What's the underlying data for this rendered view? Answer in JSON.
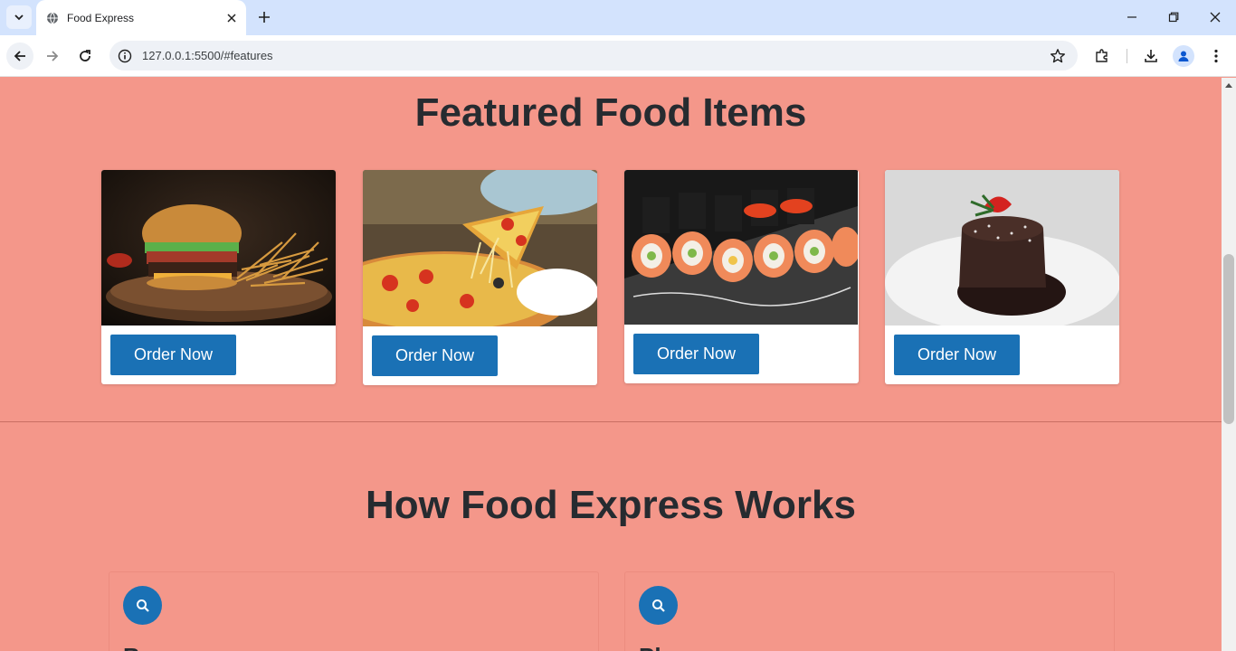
{
  "browser": {
    "tab_title": "Food Express",
    "url": "127.0.0.1:5500/#features"
  },
  "featured": {
    "title": "Featured Food Items",
    "items": [
      {
        "name": "burger",
        "button": "Order Now"
      },
      {
        "name": "pizza",
        "button": "Order Now"
      },
      {
        "name": "sushi",
        "button": "Order Now"
      },
      {
        "name": "lava-cake",
        "button": "Order Now"
      }
    ]
  },
  "how_it_works": {
    "title": "How Food Express Works",
    "steps": [
      {
        "icon": "search-icon",
        "heading": "B"
      },
      {
        "icon": "search-icon",
        "heading": "Pl"
      }
    ]
  },
  "colors": {
    "page_bg": "#f4978a",
    "accent": "#1a71b5",
    "heading": "#262b30"
  }
}
